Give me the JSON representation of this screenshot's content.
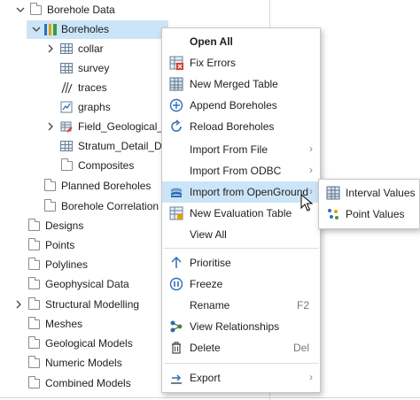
{
  "tree": {
    "items": [
      {
        "label": "Borehole Data",
        "level": 0,
        "chevron": "expanded",
        "icon": "folder-icon"
      },
      {
        "label": "Boreholes",
        "level": 1,
        "chevron": "expanded",
        "icon": "boreholes-icon",
        "selected": true
      },
      {
        "label": "collar",
        "level": 2,
        "chevron": "collapsed",
        "icon": "table-icon"
      },
      {
        "label": "survey",
        "level": 2,
        "chevron": "none",
        "icon": "table-icon"
      },
      {
        "label": "traces",
        "level": 2,
        "chevron": "none",
        "icon": "traces-icon"
      },
      {
        "label": "graphs",
        "level": 2,
        "chevron": "none",
        "icon": "graph-icon"
      },
      {
        "label": "Field_Geological_De",
        "level": 2,
        "chevron": "collapsed",
        "icon": "table-edit-icon"
      },
      {
        "label": "Stratum_Detail_Des",
        "level": 2,
        "chevron": "none",
        "icon": "table-icon"
      },
      {
        "label": "Composites",
        "level": 2,
        "chevron": "none",
        "icon": "folder-icon"
      },
      {
        "label": "Planned Boreholes",
        "level": 1,
        "chevron": "none",
        "icon": "folder-icon"
      },
      {
        "label": "Borehole Correlation",
        "level": 1,
        "chevron": "none",
        "icon": "folder-icon"
      },
      {
        "label": "Designs",
        "level": 0,
        "chevron": "none",
        "icon": "folder-icon"
      },
      {
        "label": "Points",
        "level": 0,
        "chevron": "none",
        "icon": "folder-icon"
      },
      {
        "label": "Polylines",
        "level": 0,
        "chevron": "none",
        "icon": "folder-icon"
      },
      {
        "label": "Geophysical Data",
        "level": 0,
        "chevron": "none",
        "icon": "folder-icon"
      },
      {
        "label": "Structural Modelling",
        "level": 0,
        "chevron": "collapsed",
        "icon": "folder-icon"
      },
      {
        "label": "Meshes",
        "level": 0,
        "chevron": "none",
        "icon": "folder-icon"
      },
      {
        "label": "Geological Models",
        "level": 0,
        "chevron": "none",
        "icon": "folder-icon"
      },
      {
        "label": "Numeric Models",
        "level": 0,
        "chevron": "none",
        "icon": "folder-icon"
      },
      {
        "label": "Combined Models",
        "level": 0,
        "chevron": "none",
        "icon": "folder-icon"
      }
    ]
  },
  "menu": {
    "open_all": "Open All",
    "fix_errors": "Fix Errors",
    "new_merged_table": "New Merged Table",
    "append_boreholes": "Append Boreholes",
    "reload_boreholes": "Reload Boreholes",
    "import_from_file": "Import From File",
    "import_from_odbc": "Import From ODBC",
    "import_from_openground": "Import from OpenGround",
    "new_evaluation_table": "New Evaluation Table",
    "view_all": "View All",
    "prioritise": "Prioritise",
    "freeze": "Freeze",
    "rename": "Rename",
    "rename_shortcut": "F2",
    "view_relationships": "View Relationships",
    "delete": "Delete",
    "delete_shortcut": "Del",
    "export": "Export",
    "submenu_arrow": "›"
  },
  "submenu": {
    "interval_values": "Interval Values",
    "point_values": "Point Values"
  },
  "chevrons": {
    "expanded": "⌵",
    "collapsed": "›"
  },
  "colors": {
    "selection": "#cce4f7",
    "accent_blue": "#2f6fb6",
    "error_red": "#d83b2b"
  }
}
